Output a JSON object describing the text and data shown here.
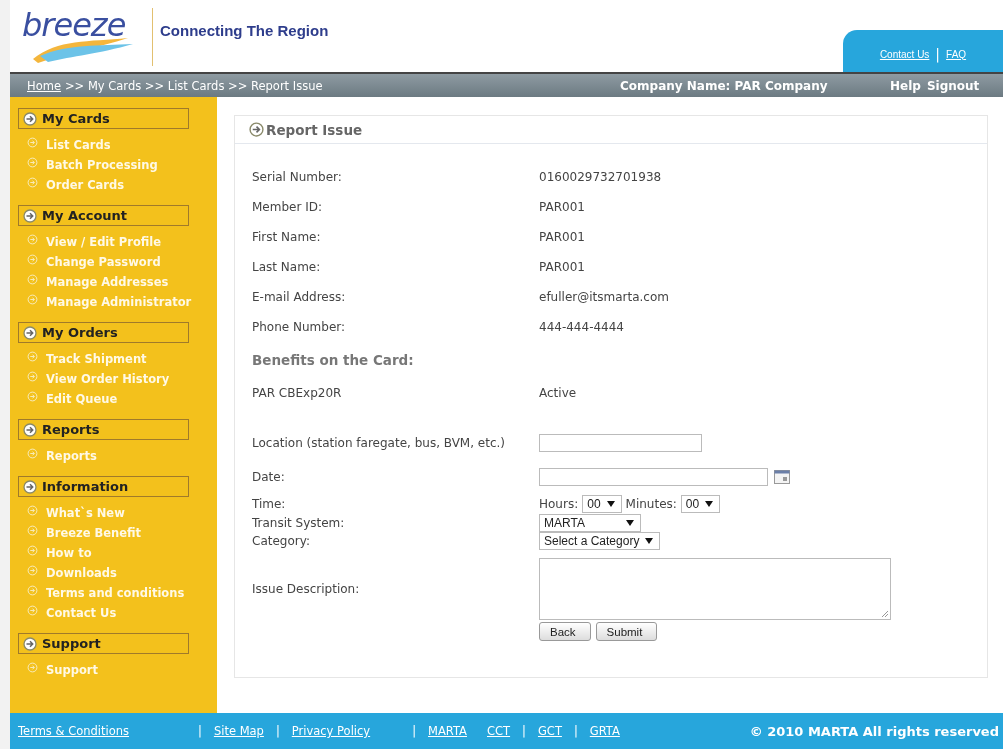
{
  "header": {
    "logo": "breeze",
    "tagline": "Connecting The Region",
    "top_links": [
      "Contact Us",
      "|",
      "FAQ"
    ]
  },
  "breadcrumb": {
    "home": "Home",
    "trail": ">> My Cards >> List Cards >> Report Issue",
    "company": "Company Name: PAR Company",
    "links": [
      "Help",
      "Signout"
    ]
  },
  "sidebar": [
    {
      "title": "My Cards",
      "items": [
        "List Cards",
        "Batch Processing",
        "Order Cards"
      ]
    },
    {
      "title": "My Account",
      "items": [
        "View / Edit Profile",
        "Change Password",
        "Manage Addresses",
        "Manage Administrator"
      ]
    },
    {
      "title": "My Orders",
      "items": [
        "Track Shipment",
        "View Order History",
        "Edit Queue"
      ]
    },
    {
      "title": "Reports",
      "items": [
        "Reports"
      ]
    },
    {
      "title": "Information",
      "items": [
        "What`s New",
        "Breeze Benefit",
        "How to",
        "Downloads",
        "Terms and conditions",
        "Contact Us"
      ]
    },
    {
      "title": "Support",
      "items": [
        "Support"
      ]
    }
  ],
  "panel": {
    "title": "Report Issue",
    "details": [
      {
        "label": "Serial Number:",
        "value": "0160029732701938"
      },
      {
        "label": "Member ID:",
        "value": "PAR001"
      },
      {
        "label": "First Name:",
        "value": "PAR001"
      },
      {
        "label": "Last Name:",
        "value": "PAR001"
      },
      {
        "label": "E-mail Address:",
        "value": "efuller@itsmarta.com"
      },
      {
        "label": "Phone Number:",
        "value": "444-444-4444"
      }
    ],
    "benefits_heading": "Benefits on the Card:",
    "benefits": [
      {
        "name": "PAR CBExp20R",
        "status": "Active"
      }
    ],
    "form": [
      {
        "kind": "text",
        "label": "Location (station faregate, bus, BVM, etc.)"
      },
      {
        "kind": "date",
        "label": "Date:"
      },
      {
        "kind": "time",
        "label": "Time:",
        "hours_label": "Hours:",
        "hours": "00",
        "minutes_label": "Minutes:",
        "minutes": "00"
      },
      {
        "kind": "select",
        "label": "Transit System:",
        "value": "MARTA"
      },
      {
        "kind": "select",
        "label": "Category:",
        "value": "Select a Category"
      },
      {
        "kind": "textarea",
        "label": "Issue Description:"
      }
    ],
    "buttons": [
      "Back",
      "Submit"
    ]
  },
  "footer": {
    "items": [
      {
        "kind": "link",
        "text": "Terms & Conditions"
      },
      {
        "kind": "sep",
        "text": "|"
      },
      {
        "kind": "link",
        "text": "Site Map"
      },
      {
        "kind": "sep",
        "text": "|"
      },
      {
        "kind": "link",
        "text": "Privacy Policy"
      },
      {
        "kind": "sep",
        "text": "|"
      },
      {
        "kind": "link",
        "text": "MARTA"
      },
      {
        "kind": "link",
        "text": "CCT"
      },
      {
        "kind": "sep",
        "text": "|"
      },
      {
        "kind": "link",
        "text": "GCT"
      },
      {
        "kind": "sep",
        "text": "|"
      },
      {
        "kind": "link",
        "text": "GRTA"
      }
    ],
    "copyright": "© 2010 MARTA All rights reserved"
  }
}
